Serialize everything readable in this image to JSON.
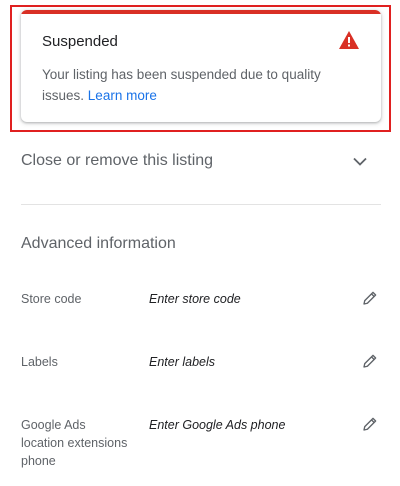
{
  "status_card": {
    "title": "Suspended",
    "message": "Your listing has been suspended due to quality issues.",
    "learn_more": "Learn more",
    "icon": "warning-icon",
    "accent_color": "#d93025"
  },
  "close_remove": {
    "label": "Close or remove this listing",
    "icon": "chevron-down-icon"
  },
  "advanced": {
    "title": "Advanced information",
    "fields": [
      {
        "label": "Store code",
        "value": "Enter store code",
        "icon": "edit-pencil-icon"
      },
      {
        "label": "Labels",
        "value": "Enter labels",
        "icon": "edit-pencil-icon"
      },
      {
        "label": "Google Ads location extensions phone",
        "value": "Enter Google Ads phone",
        "icon": "edit-pencil-icon"
      }
    ]
  },
  "colors": {
    "link": "#1a73e8",
    "highlight": "#e02020"
  }
}
